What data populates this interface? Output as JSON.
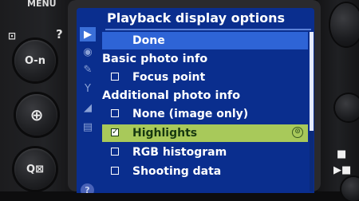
{
  "camera": {
    "menu_label": "MENU",
    "help_label": "?",
    "buttons": [
      {
        "name": "protect-button",
        "glyph": "O-n"
      },
      {
        "name": "zoom-in-button",
        "glyph": "⊕"
      },
      {
        "name": "zoom-out-button",
        "glyph": "Q⊠"
      }
    ]
  },
  "screen": {
    "title": "Playback display options",
    "tabs": [
      {
        "name": "tab-playback",
        "glyph": "▶",
        "active": true
      },
      {
        "name": "tab-shooting",
        "glyph": "◉",
        "active": false
      },
      {
        "name": "tab-custom",
        "glyph": "✎",
        "active": false
      },
      {
        "name": "tab-setup",
        "glyph": "Y",
        "active": false
      },
      {
        "name": "tab-retouch",
        "glyph": "◢",
        "active": false
      },
      {
        "name": "tab-mymenu",
        "glyph": "▤",
        "active": false
      }
    ],
    "help_glyph": "?",
    "rows": [
      {
        "type": "done",
        "label": "Done"
      },
      {
        "type": "header",
        "label": "Basic photo info"
      },
      {
        "type": "option",
        "label": "Focus point",
        "checked": false
      },
      {
        "type": "header",
        "label": "Additional photo info"
      },
      {
        "type": "option",
        "label": "None (image only)",
        "checked": false
      },
      {
        "type": "option",
        "label": "Highlights",
        "checked": true,
        "selected": true
      },
      {
        "type": "option",
        "label": "RGB histogram",
        "checked": false
      },
      {
        "type": "option",
        "label": "Shooting data",
        "checked": false
      }
    ],
    "check_mark": "✓",
    "ok_glyph": "⊙",
    "colors": {
      "background": "#0a2e8e",
      "done_bar": "#2e64d6",
      "highlight_bar": "#a8c95a",
      "text": "#ffffff"
    }
  }
}
